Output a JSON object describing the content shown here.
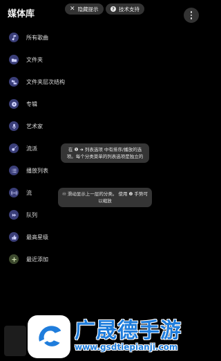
{
  "header": {
    "title": "媒体库",
    "hide_tips_label": "隐藏提示",
    "support_label": "技术支持"
  },
  "menu": {
    "items": [
      {
        "label": "所有歌曲",
        "icon": "music-note-icon"
      },
      {
        "label": "文件夹",
        "icon": "folder-icon"
      },
      {
        "label": "文件夹层次结构",
        "icon": "folder-tree-icon"
      },
      {
        "label": "专辑",
        "icon": "album-disc-icon"
      },
      {
        "label": "艺术家",
        "icon": "microphone-icon"
      },
      {
        "label": "流派",
        "icon": "guitar-icon"
      },
      {
        "label": "播放列表",
        "icon": "playlist-icon"
      },
      {
        "label": "流",
        "icon": "stream-icon"
      },
      {
        "label": "队列",
        "icon": "queue-icon"
      },
      {
        "label": "最高星级",
        "icon": "thumbs-up-icon"
      },
      {
        "label": "最近添加",
        "icon": "plus-icon"
      }
    ]
  },
  "tips": {
    "tip1": "在 ❶ ➜ 列表选项 中有排序/播放的选项。每个分类菜单的列表选项是独立的",
    "tip2": "♾ 滑动显示上一层的分类。 使用 ❷ 手势可以缩放"
  },
  "watermark": {
    "brand": "广晟德手游",
    "url": "www.gsdtiepianji.com"
  },
  "colors": {
    "background": "#000000",
    "icon_badge": "#3a3e78",
    "chip": "#333333",
    "watermark_blue": "#1f7ddc"
  }
}
